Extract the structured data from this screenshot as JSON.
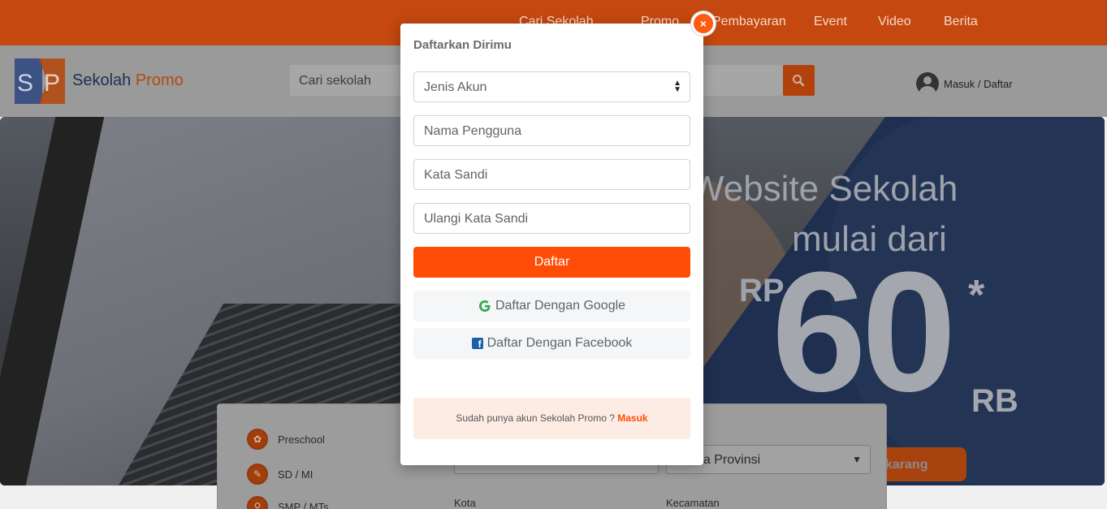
{
  "topnav": {
    "items": [
      "Cari Sekolah",
      "Promo",
      "Pembayaran",
      "Event",
      "Video",
      "Berita"
    ]
  },
  "header": {
    "brand_main": "Sekolah",
    "brand_accent": "Promo",
    "logo_letters": "SP",
    "search_placeholder": "Cari sekolah",
    "account_label": "Masuk / Daftar"
  },
  "hero": {
    "line1": "Website Sekolah",
    "line2": "mulai dari",
    "currency": "RP",
    "price": "60",
    "star": "*",
    "unit": "RB",
    "cta_label": "karang"
  },
  "panel": {
    "categories": [
      "Preschool",
      "SD / MI",
      "SMP / MTs"
    ],
    "province_select": "na Provinsi",
    "label_city": "Kota",
    "label_district": "Kecamatan"
  },
  "modal": {
    "title": "Daftarkan Dirimu",
    "account_type": "Jenis Akun",
    "username_placeholder": "Nama Pengguna",
    "password_placeholder": "Kata Sandi",
    "confirm_placeholder": "Ulangi Kata Sandi",
    "submit_label": "Daftar",
    "google_label": "Daftar Dengan Google",
    "facebook_label": "Daftar Dengan Facebook",
    "login_prompt": "Sudah punya akun Sekolah Promo ?",
    "login_link": "Masuk",
    "close_symbol": "×"
  },
  "colors": {
    "brand_orange": "#ff4d08",
    "brand_navy": "#1c2f55",
    "google_green": "#34a853",
    "facebook_blue": "#1a5fae"
  }
}
